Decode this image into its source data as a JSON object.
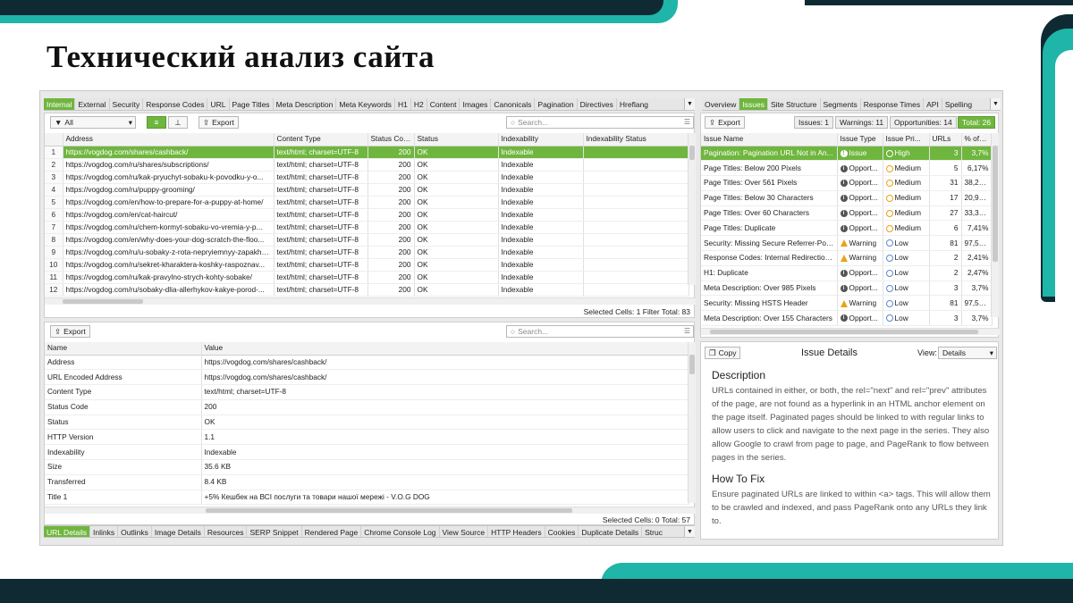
{
  "slide": {
    "title": "Технический анализ сайта"
  },
  "colors": {
    "dark": "#0f2a33",
    "teal": "#1fb5a9",
    "accent": "#6fb63e"
  },
  "top_tabs": [
    "Internal",
    "External",
    "Security",
    "Response Codes",
    "URL",
    "Page Titles",
    "Meta Description",
    "Meta Keywords",
    "H1",
    "H2",
    "Content",
    "Images",
    "Canonicals",
    "Pagination",
    "Directives",
    "Hreflang"
  ],
  "top_toolbar": {
    "filter": "All",
    "export": "Export",
    "search_placeholder": "Search..."
  },
  "url_table": {
    "headers": [
      "",
      "Address",
      "Content Type",
      "Status Code",
      "Status",
      "Indexability",
      "Indexability Status"
    ],
    "rows": [
      [
        "1",
        "https://vogdog.com/shares/cashback/",
        "text/html; charset=UTF-8",
        "200",
        "OK",
        "Indexable",
        ""
      ],
      [
        "2",
        "https://vogdog.com/ru/shares/subscriptions/",
        "text/html; charset=UTF-8",
        "200",
        "OK",
        "Indexable",
        ""
      ],
      [
        "3",
        "https://vogdog.com/ru/kak-pryuchyt-sobaku-k-povodku-y-o...",
        "text/html; charset=UTF-8",
        "200",
        "OK",
        "Indexable",
        ""
      ],
      [
        "4",
        "https://vogdog.com/ru/puppy-grooming/",
        "text/html; charset=UTF-8",
        "200",
        "OK",
        "Indexable",
        ""
      ],
      [
        "5",
        "https://vogdog.com/en/how-to-prepare-for-a-puppy-at-home/",
        "text/html; charset=UTF-8",
        "200",
        "OK",
        "Indexable",
        ""
      ],
      [
        "6",
        "https://vogdog.com/en/cat-haircut/",
        "text/html; charset=UTF-8",
        "200",
        "OK",
        "Indexable",
        ""
      ],
      [
        "7",
        "https://vogdog.com/ru/chem-kormyt-sobaku-vo-vremia-y-p...",
        "text/html; charset=UTF-8",
        "200",
        "OK",
        "Indexable",
        ""
      ],
      [
        "8",
        "https://vogdog.com/en/why-does-your-dog-scratch-the-floo...",
        "text/html; charset=UTF-8",
        "200",
        "OK",
        "Indexable",
        ""
      ],
      [
        "9",
        "https://vogdog.com/ru/u-sobaky-z-rota-nepryiemnyy-zapakh-ia...",
        "text/html; charset=UTF-8",
        "200",
        "OK",
        "Indexable",
        ""
      ],
      [
        "10",
        "https://vogdog.com/ru/sekret-kharaktera-koshky-raspoznav...",
        "text/html; charset=UTF-8",
        "200",
        "OK",
        "Indexable",
        ""
      ],
      [
        "11",
        "https://vogdog.com/ru/kak-pravylno-strych-kohty-sobake/",
        "text/html; charset=UTF-8",
        "200",
        "OK",
        "Indexable",
        ""
      ],
      [
        "12",
        "https://vogdog.com/ru/sobaky-dlia-allerhykov-kakye-porod-...",
        "text/html; charset=UTF-8",
        "200",
        "OK",
        "Indexable",
        ""
      ]
    ],
    "status": "Selected Cells:  1  Filter Total:  83"
  },
  "detail_toolbar": {
    "export": "Export",
    "search_placeholder": "Search..."
  },
  "detail_table": {
    "headers": [
      "Name",
      "Value"
    ],
    "rows": [
      [
        "Address",
        "https://vogdog.com/shares/cashback/"
      ],
      [
        "URL Encoded Address",
        "https://vogdog.com/shares/cashback/"
      ],
      [
        "Content Type",
        "text/html; charset=UTF-8"
      ],
      [
        "Status Code",
        "200"
      ],
      [
        "Status",
        "OK"
      ],
      [
        "HTTP Version",
        "1.1"
      ],
      [
        "Indexability",
        "Indexable"
      ],
      [
        "Size",
        "35.6 KB"
      ],
      [
        "Transferred",
        "8.4 KB"
      ],
      [
        "Title 1",
        "+5% Кешбек на ВСІ послуги та товари нашої мережі - V.O.G DOG"
      ]
    ],
    "status": "Selected Cells:  0  Total:  57"
  },
  "bottom_tabs": [
    "URL Details",
    "Inlinks",
    "Outlinks",
    "Image Details",
    "Resources",
    "SERP Snippet",
    "Rendered Page",
    "Chrome Console Log",
    "View Source",
    "HTTP Headers",
    "Cookies",
    "Duplicate Details",
    "Struc"
  ],
  "right_tabs": [
    "Overview",
    "Issues",
    "Site Structure",
    "Segments",
    "Response Times",
    "API",
    "Spelling"
  ],
  "issues_toolbar": {
    "export": "Export",
    "issues": "Issues: 1",
    "warnings": "Warnings: 11",
    "opportunities": "Opportunities: 14",
    "total": "Total: 26"
  },
  "issues_table": {
    "headers": [
      "Issue Name",
      "Issue Type",
      "Issue Pri...",
      "URLs",
      "% of T..."
    ],
    "rows": [
      {
        "name": "Pagination: Pagination URL Not in An...",
        "type": "Issue",
        "prio": "High",
        "urls": "3",
        "pct": "3,7%"
      },
      {
        "name": "Page Titles: Below 200 Pixels",
        "type": "Opport...",
        "prio": "Medium",
        "urls": "5",
        "pct": "6,17%"
      },
      {
        "name": "Page Titles: Over 561 Pixels",
        "type": "Opport...",
        "prio": "Medium",
        "urls": "31",
        "pct": "38,27%"
      },
      {
        "name": "Page Titles: Below 30 Characters",
        "type": "Opport...",
        "prio": "Medium",
        "urls": "17",
        "pct": "20,99%"
      },
      {
        "name": "Page Titles: Over 60 Characters",
        "type": "Opport...",
        "prio": "Medium",
        "urls": "27",
        "pct": "33,33%"
      },
      {
        "name": "Page Titles: Duplicate",
        "type": "Opport...",
        "prio": "Medium",
        "urls": "6",
        "pct": "7,41%"
      },
      {
        "name": "Security: Missing Secure Referrer-Poli...",
        "type": "Warning",
        "prio": "Low",
        "urls": "81",
        "pct": "97,59%"
      },
      {
        "name": "Response Codes: Internal Redirection...",
        "type": "Warning",
        "prio": "Low",
        "urls": "2",
        "pct": "2,41%"
      },
      {
        "name": "H1: Duplicate",
        "type": "Opport...",
        "prio": "Low",
        "urls": "2",
        "pct": "2,47%"
      },
      {
        "name": "Meta Description: Over 985 Pixels",
        "type": "Opport...",
        "prio": "Low",
        "urls": "3",
        "pct": "3,7%"
      },
      {
        "name": "Security: Missing HSTS Header",
        "type": "Warning",
        "prio": "Low",
        "urls": "81",
        "pct": "97,59%"
      },
      {
        "name": "Meta Description: Over 155 Characters",
        "type": "Opport...",
        "prio": "Low",
        "urls": "3",
        "pct": "3,7%"
      }
    ]
  },
  "issue_details": {
    "copy": "Copy",
    "title": "Issue Details",
    "view_label": "View:",
    "view_value": "Details",
    "desc_heading": "Description",
    "desc_text": "URLs contained in either, or both, the rel=\"next\" and rel=\"prev\" attributes of the page, are not found as a hyperlink in an HTML anchor element on the page itself. Paginated pages should be linked to with regular links to allow users to click and navigate to the next page in the series. They also allow Google to crawl from page to page, and PageRank to flow between pages in the series.",
    "fix_heading": "How To Fix",
    "fix_text": "Ensure paginated URLs are linked to within <a> tags. This will allow them to be crawled and indexed, and pass PageRank onto any URLs they link to."
  }
}
